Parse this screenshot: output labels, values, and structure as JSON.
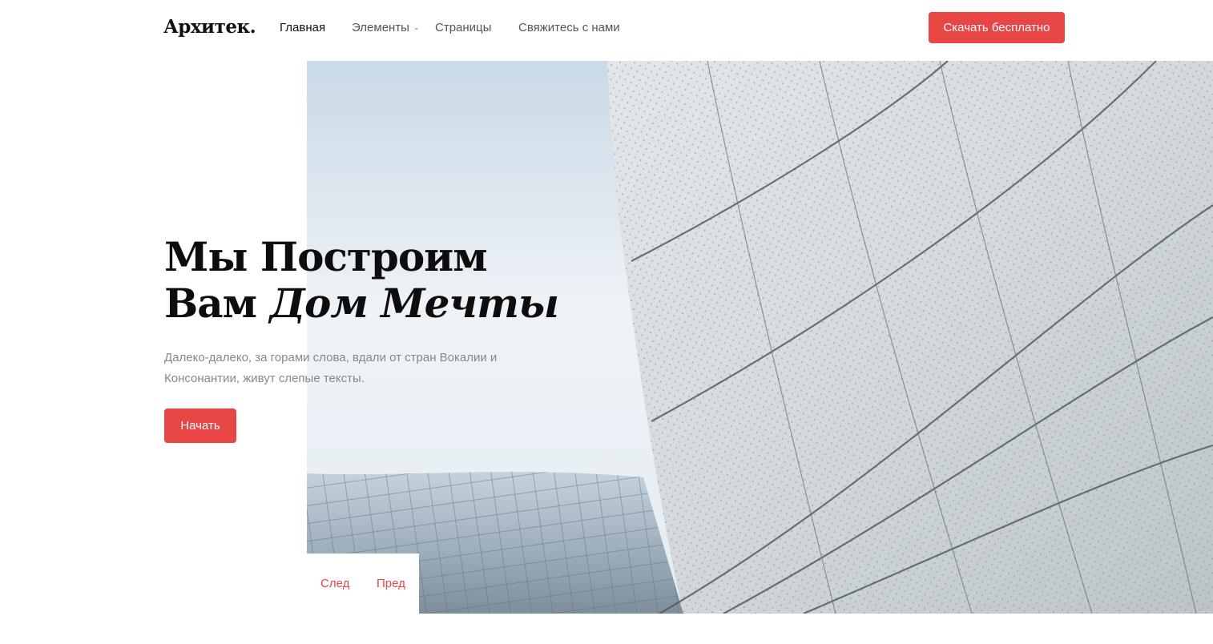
{
  "brand": {
    "logo": "Архитек."
  },
  "nav": {
    "home": "Главная",
    "elements": "Элементы",
    "pages": "Страницы",
    "contact": "Свяжитесь с нами"
  },
  "header": {
    "cta_label": "Скачать бесплатно"
  },
  "hero": {
    "title_line1": "Мы Построим",
    "title_line2_plain": "Вам",
    "title_line2_italic": "Дом Мечты",
    "text": "Далеко-далеко, за горами слова, вдали от стран Вокалии и Консонантии, живут слепые тексты.",
    "button_label": "Начать"
  },
  "slider": {
    "next_label": "След",
    "prev_label": "Пред"
  },
  "colors": {
    "accent": "#e84545",
    "title": "#0d0d0d",
    "muted": "#888888"
  }
}
